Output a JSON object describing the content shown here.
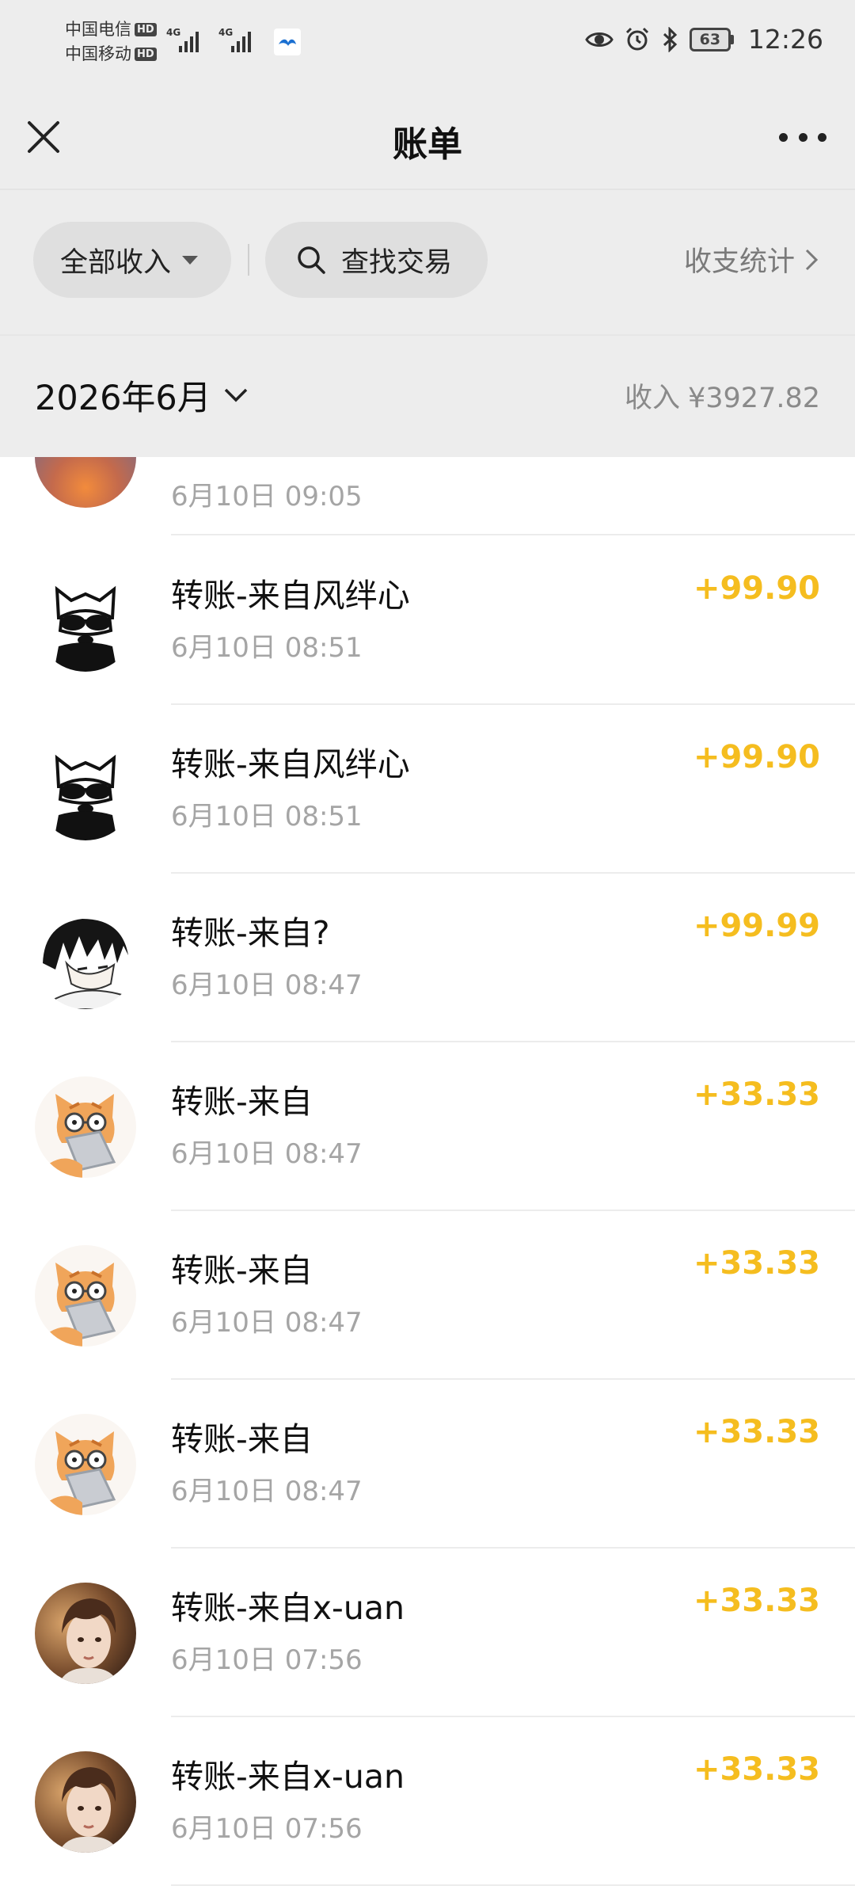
{
  "status_bar": {
    "carrier1": "中国电信",
    "carrier2": "中国移动",
    "hd_label": "HD",
    "network1": "4G",
    "network2": "4G",
    "battery": "63",
    "time": "12:26",
    "icons": [
      "eye-icon",
      "alarm-icon",
      "bluetooth-icon"
    ]
  },
  "nav": {
    "title": "账单"
  },
  "filters": {
    "type_label": "全部收入",
    "search_label": "查找交易",
    "stats_label": "收支统计"
  },
  "month": {
    "label": "2026年6月",
    "income_label": "收入",
    "income_amount": "¥3927.82"
  },
  "partial_row": {
    "time": "6月10日 09:05"
  },
  "transactions": [
    {
      "title": "转账-来自风绊心",
      "time": "6月10日 08:51",
      "amount": "+99.90",
      "avatar": "dog-sunglasses"
    },
    {
      "title": "转账-来自风绊心",
      "time": "6月10日 08:51",
      "amount": "+99.90",
      "avatar": "dog-sunglasses"
    },
    {
      "title": "转账-来自?",
      "time": "6月10日 08:47",
      "amount": "+99.99",
      "avatar": "anime-boy"
    },
    {
      "title": "转账-来自",
      "time": "6月10日 08:47",
      "amount": "+33.33",
      "avatar": "cat-laptop"
    },
    {
      "title": "转账-来自",
      "time": "6月10日 08:47",
      "amount": "+33.33",
      "avatar": "cat-laptop"
    },
    {
      "title": "转账-来自",
      "time": "6月10日 08:47",
      "amount": "+33.33",
      "avatar": "cat-laptop"
    },
    {
      "title": "转账-来自x-uan",
      "time": "6月10日 07:56",
      "amount": "+33.33",
      "avatar": "person-photo"
    },
    {
      "title": "转账-来自x-uan",
      "time": "6月10日 07:56",
      "amount": "+33.33",
      "avatar": "person-photo"
    }
  ],
  "colors": {
    "amount": "#f5bd1f",
    "header_bg": "#ededed",
    "muted_text": "#a5a5a5"
  }
}
